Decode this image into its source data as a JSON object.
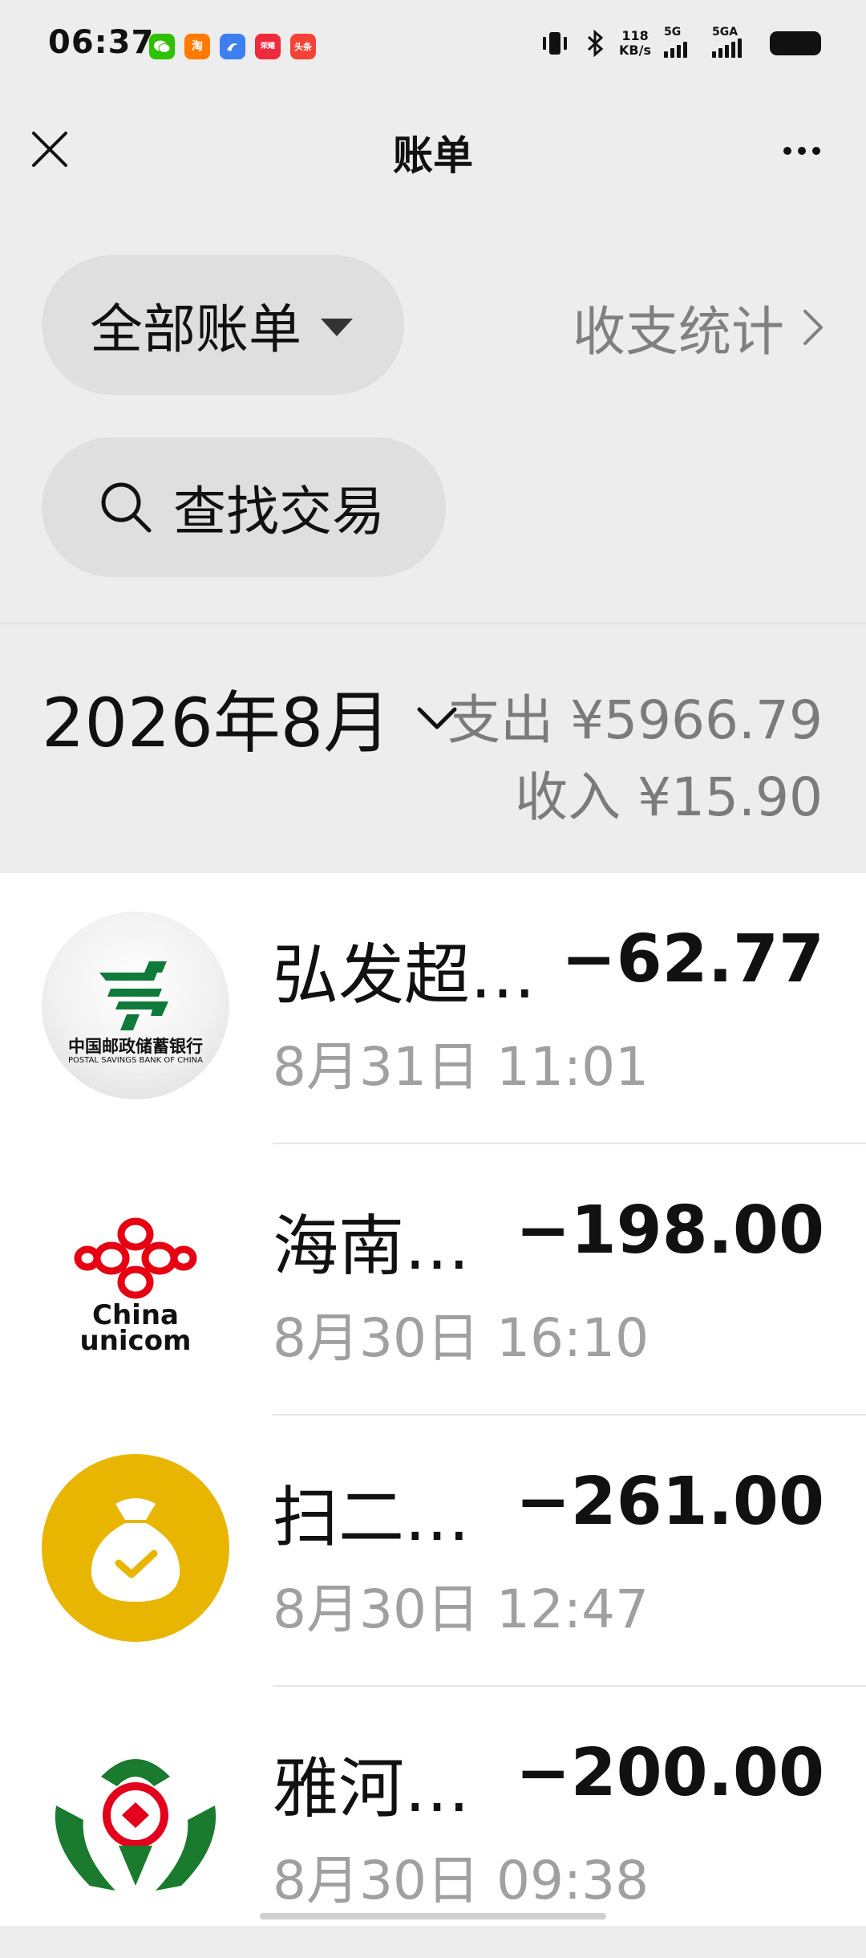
{
  "status_bar": {
    "time": "06:37",
    "app_icons": [
      {
        "name": "wechat",
        "label": "",
        "color": "#2dc100"
      },
      {
        "name": "taobao",
        "label": "淘",
        "color": "#ff7a00"
      },
      {
        "name": "tencent-map",
        "label": "",
        "color": "#3d7ef0"
      },
      {
        "name": "honor",
        "label": "荣耀",
        "color": "#ee2a3c"
      },
      {
        "name": "toutiao",
        "label": "头条",
        "color": "#f44336"
      }
    ],
    "net_speed_value": "118",
    "net_speed_unit": "KB/s",
    "signal_1": "5G",
    "signal_2": "5GA"
  },
  "nav": {
    "title": "账单"
  },
  "filter": {
    "all_bills_label": "全部账单",
    "stats_label": "收支统计"
  },
  "search": {
    "label": "查找交易"
  },
  "summary": {
    "month": "2026年8月",
    "expense": "支出 ¥5966.79",
    "income": "收入 ¥15.90"
  },
  "transactions": [
    {
      "name": "弘发超…",
      "amount": "−62.77",
      "date": "8月31日 11:01",
      "icon": "postal-savings-bank-logo",
      "icon_text": "中国邮政储蓄银行",
      "icon_text_en": "POSTAL SAVINGS BANK OF CHINA"
    },
    {
      "name": "海南…",
      "amount": "−198.00",
      "date": "8月30日 16:10",
      "icon": "china-unicom-logo",
      "icon_text": "China",
      "icon_text_en": "unicom"
    },
    {
      "name": "扫二…",
      "amount": "−261.00",
      "date": "8月30日 12:47",
      "icon": "money-bag-icon"
    },
    {
      "name": "雅河…",
      "amount": "−200.00",
      "date": "8月30日 09:38",
      "icon": "rural-bank-logo"
    }
  ],
  "colors": {
    "background": "#ededed",
    "pill": "#dfdfdf",
    "psbc_green": "#0f7a3a",
    "unicom_red": "#e60012",
    "money_bag_yellow": "#e8b600",
    "rural_green": "#1a7a2e",
    "rural_red": "#e4001c"
  }
}
